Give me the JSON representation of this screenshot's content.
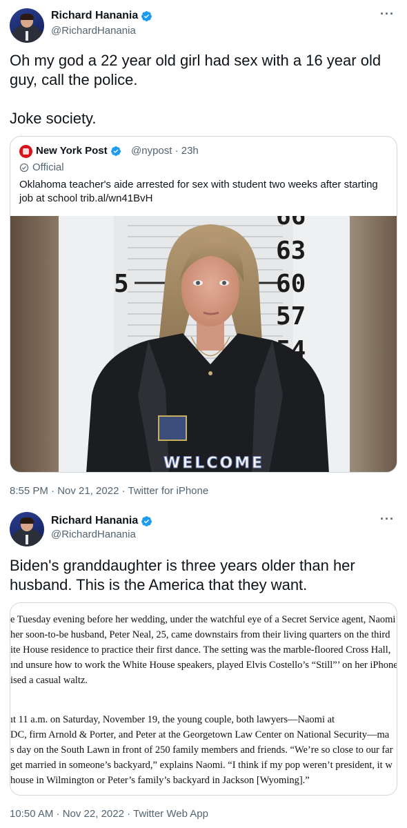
{
  "tweet1": {
    "author": {
      "name": "Richard Hanania",
      "handle": "@RichardHanania"
    },
    "more_icon": "more-horizontal-icon",
    "text_line1": "Oh my god a 22 year old girl had sex with a 16 year old",
    "text_line2": "guy, call the police.",
    "text_line3": "Joke society.",
    "quote": {
      "name": "New York Post",
      "handle_time": "@nypost · 23h",
      "official": "Official",
      "text_line1": "Oklahoma teacher's aide arrested for sex with student two weeks after starting",
      "text_line2": "job at school trib.al/wn41BvH",
      "photo": {
        "height_marks": [
          "66",
          "63",
          "60",
          "57",
          "54"
        ],
        "side_mark": "5",
        "shirt_text": "WELCOME"
      }
    },
    "timestamp": "8:55 PM · Nov 21, 2022 · Twitter for iPhone"
  },
  "tweet2": {
    "author": {
      "name": "Richard Hanania",
      "handle": "@RichardHanania"
    },
    "more_icon": "more-horizontal-icon",
    "text_line1": "Biden's granddaughter is three years older than her",
    "text_line2": "husband. This is the America that they want.",
    "clipping": {
      "lines": [
        "e Tuesday evening before her wedding, under the watchful eye of a Secret Service agent, Naomi",
        " her soon-to-be husband, Peter Neal, 25, came downstairs from their living quarters on the third",
        "ite House residence to practice their first dance. The setting was the marble-floored Cross Hall,",
        "ınd unsure how to work the White House speakers, played Elvis Costello’s “Still”’ on her iPhone",
        "ised a casual waltz.",
        "ıt 11 a.m. on Saturday, November 19, the young couple, both lawyers—Naomi at",
        "DC, firm Arnold & Porter, and Peter at the Georgetown Law Center on National Security—ma",
        "s day on the South Lawn in front of 250 family members and friends. “We’re so close to our far",
        " get married in someone’s backyard,” explains Naomi. “I think if my pop weren’t president, it w",
        " house in Wilmington or Peter’s family’s backyard in Jackson [Wyoming].”"
      ]
    },
    "timestamp": "10:50 AM · Nov 22, 2022 · Twitter Web App"
  },
  "colors": {
    "verified": "#1d9bf0",
    "secondary_text": "#536471",
    "border": "#cfd9de",
    "nypost_red": "#d7141a"
  }
}
